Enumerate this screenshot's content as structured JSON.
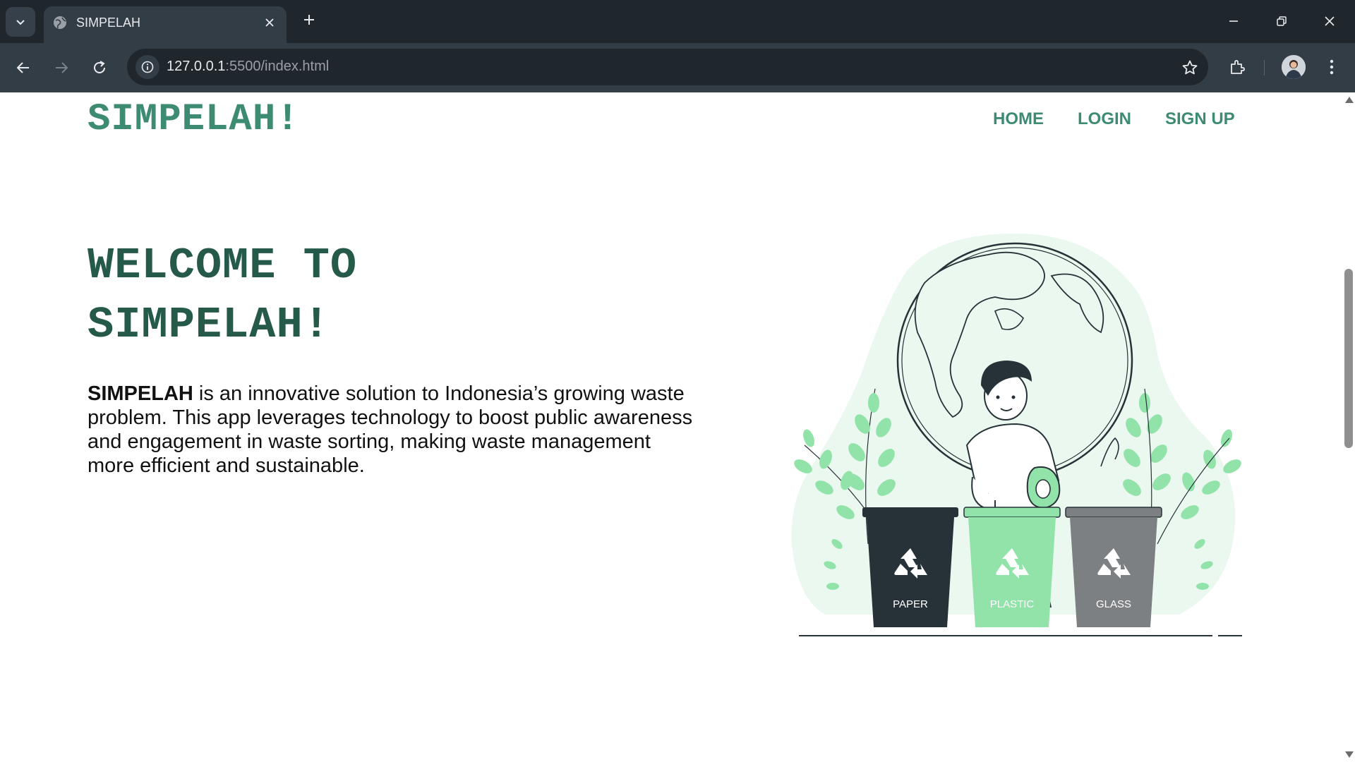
{
  "browser": {
    "tab_title": "SIMPELAH",
    "url_host": "127.0.0.1",
    "url_rest": ":5500/index.html"
  },
  "page": {
    "brand": "SIMPELAH!",
    "nav": [
      {
        "label": "HOME"
      },
      {
        "label": "LOGIN"
      },
      {
        "label": "SIGN UP"
      }
    ],
    "hero": {
      "title_line1": "WELCOME TO",
      "title_line2": "SIMPELAH!",
      "desc_bold": "SIMPELAH",
      "desc_rest": " is an innovative solution to Indonesia’s growing waste problem. This app leverages technology to boost public awareness and engagement in waste sorting, making waste management more efficient and sustainable."
    },
    "bins": [
      {
        "label": "PAPER",
        "color": "#263238"
      },
      {
        "label": "PLASTIC",
        "color": "#92e3a9"
      },
      {
        "label": "GLASS",
        "color": "#7d8083"
      }
    ]
  },
  "colors": {
    "brand_green": "#3d8b73",
    "title_green": "#255a4a",
    "chrome_dark": "#1f262c",
    "chrome_mid": "#333d46"
  },
  "icons": [
    "tab-search-icon",
    "globe-icon",
    "close-icon",
    "plus-icon",
    "minimize-icon",
    "restore-icon",
    "back-icon",
    "forward-icon",
    "reload-icon",
    "info-icon",
    "star-icon",
    "extensions-icon",
    "kebab-menu-icon",
    "recycle-icon"
  ]
}
